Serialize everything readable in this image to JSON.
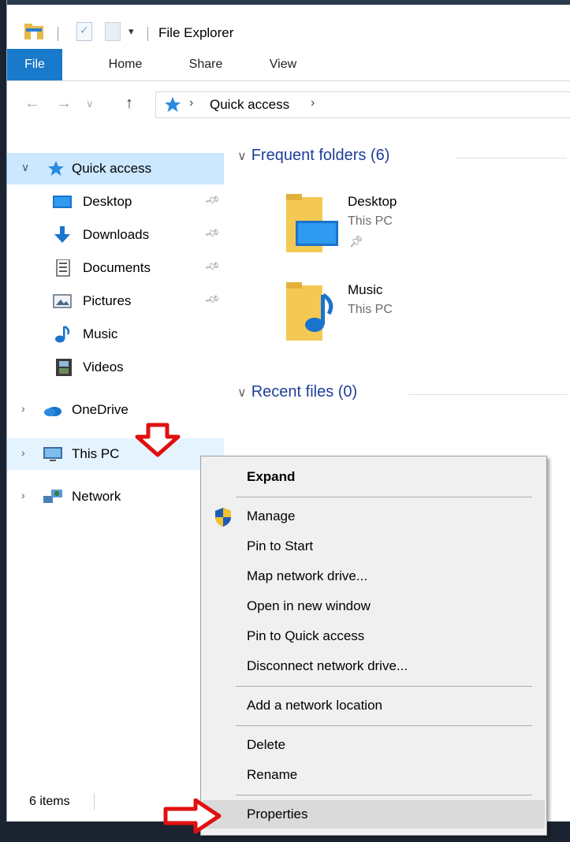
{
  "window": {
    "title": "File Explorer"
  },
  "ribbon": {
    "tabs": [
      {
        "label": "File"
      },
      {
        "label": "Home"
      },
      {
        "label": "Share"
      },
      {
        "label": "View"
      }
    ]
  },
  "address": {
    "path": "Quick access"
  },
  "sidebar": {
    "quick_access": {
      "label": "Quick access"
    },
    "items": [
      {
        "label": "Desktop",
        "pinned": true
      },
      {
        "label": "Downloads",
        "pinned": true
      },
      {
        "label": "Documents",
        "pinned": true
      },
      {
        "label": "Pictures",
        "pinned": true
      },
      {
        "label": "Music",
        "pinned": false
      },
      {
        "label": "Videos",
        "pinned": false
      }
    ],
    "onedrive": {
      "label": "OneDrive"
    },
    "this_pc": {
      "label": "This PC"
    },
    "network": {
      "label": "Network"
    }
  },
  "main": {
    "frequent_header": "Frequent folders (6)",
    "recent_header": "Recent files (0)",
    "folders": [
      {
        "name": "Desktop",
        "location": "This PC",
        "pinned": true
      },
      {
        "name": "Music",
        "location": "This PC",
        "pinned": false
      }
    ]
  },
  "status": {
    "items_count": "6 items"
  },
  "context_menu": {
    "items": [
      {
        "label": "Expand"
      },
      {
        "label": "Manage"
      },
      {
        "label": "Pin to Start"
      },
      {
        "label": "Map network drive..."
      },
      {
        "label": "Open in new window"
      },
      {
        "label": "Pin to Quick access"
      },
      {
        "label": "Disconnect network drive..."
      },
      {
        "label": "Add a network location"
      },
      {
        "label": "Delete"
      },
      {
        "label": "Rename"
      },
      {
        "label": "Properties"
      }
    ]
  },
  "colors": {
    "accent": "#1979ca",
    "selection": "#cce8ff",
    "header_blue": "#1e3f9a",
    "annotation_red": "#e01010"
  }
}
